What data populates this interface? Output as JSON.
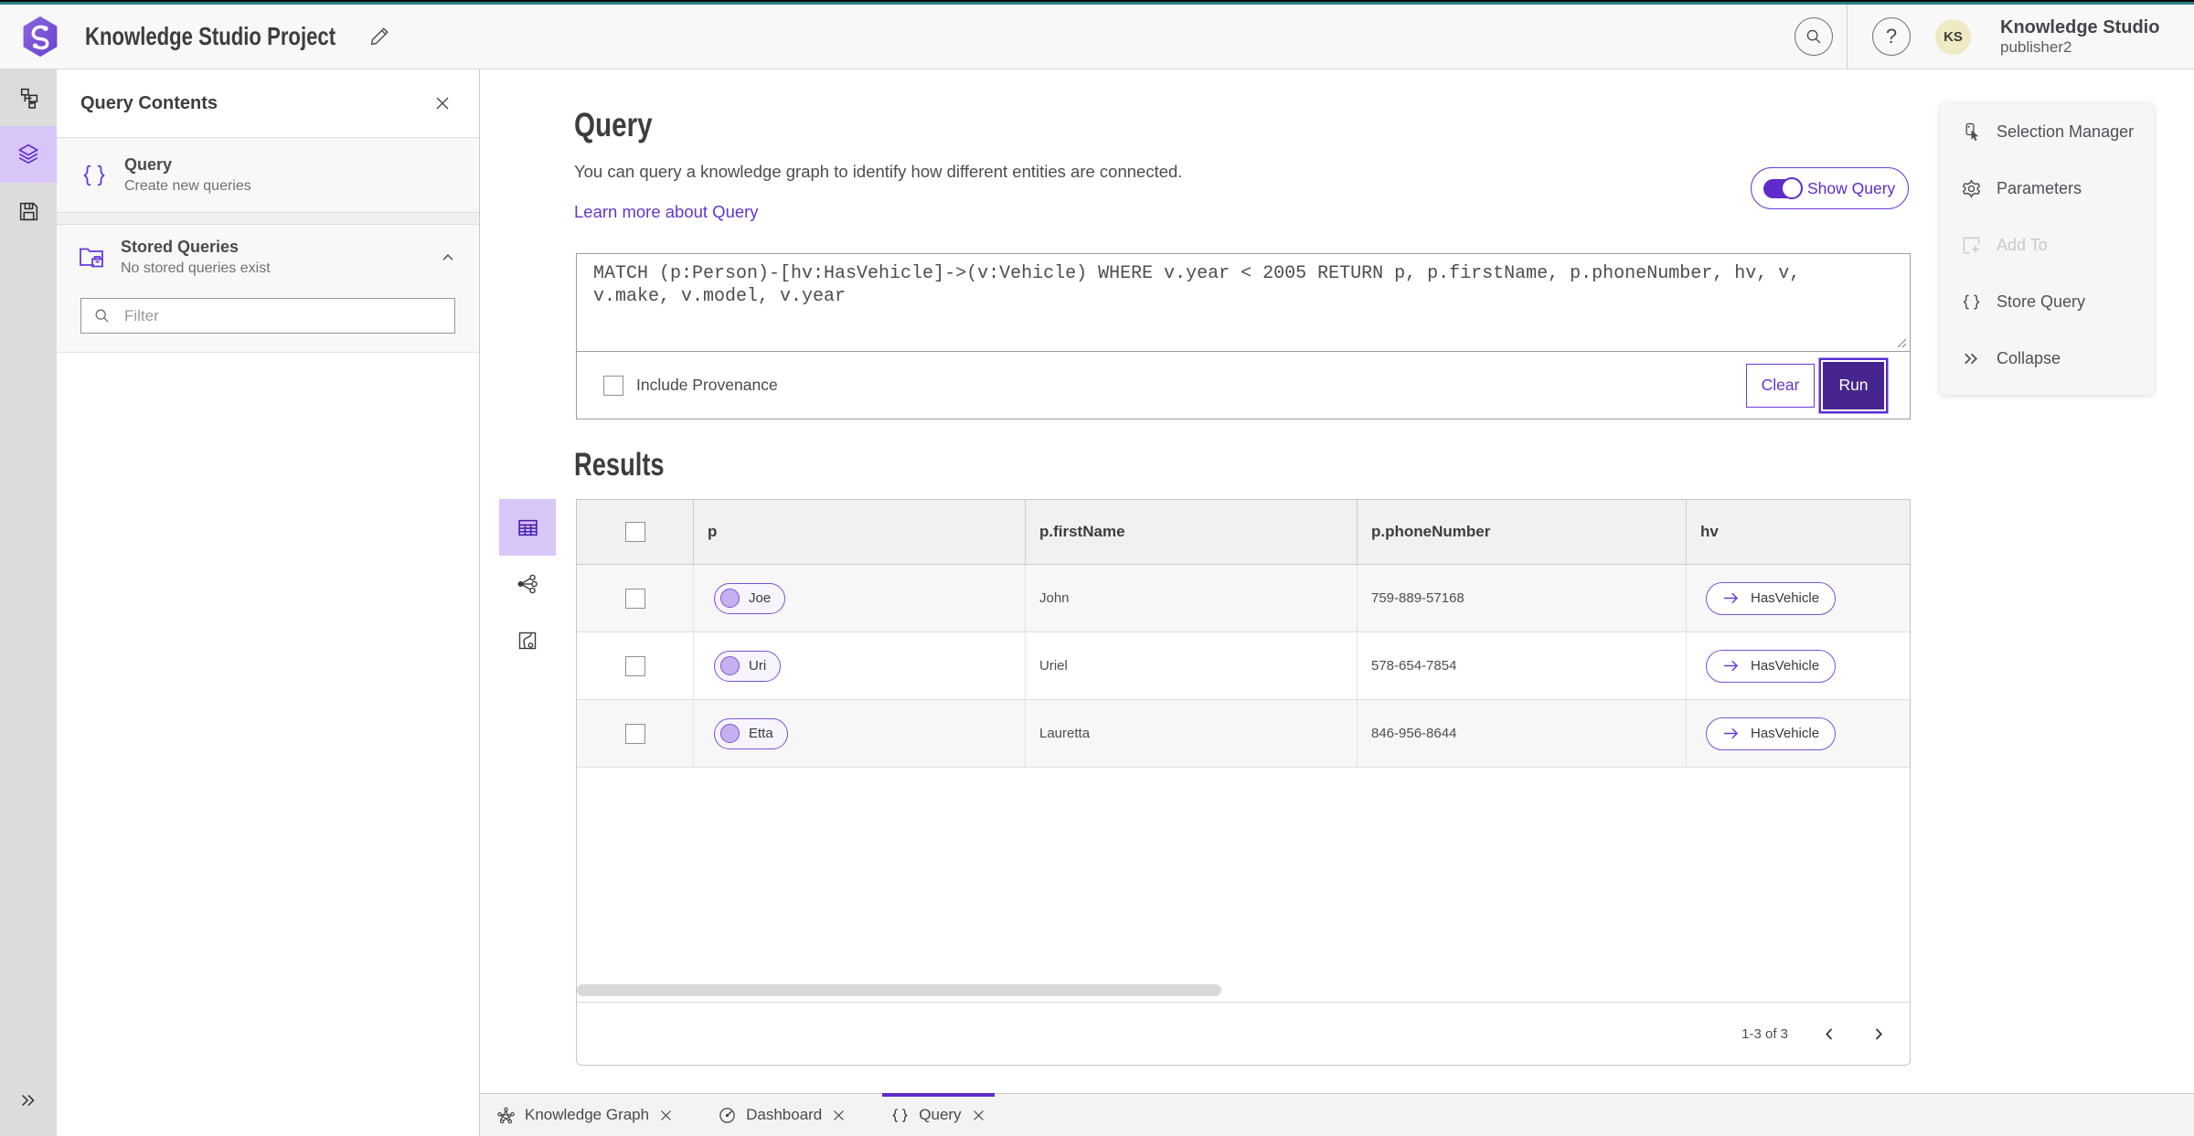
{
  "app": {
    "title": "Knowledge Studio Project",
    "user_name": "Knowledge Studio",
    "user_role": "publisher2",
    "avatar_initials": "KS"
  },
  "colors": {
    "brand_purple": "#5e2ccc",
    "selected_rail_bg": "#d9c6f9",
    "top_strip_teal": "#2e7e86",
    "run_button_fill": "#46268e",
    "avatar_bg": "#efeac3"
  },
  "icons": [
    "data-model-icon",
    "layers-icon",
    "save-icon",
    "expand-icon",
    "braces-icon",
    "stored-queries-folder-icon",
    "search-icon",
    "help-icon",
    "edit-pencil-icon",
    "close-icon",
    "chevron-up-icon",
    "table-view-icon",
    "graph-view-icon",
    "map-view-icon",
    "arrow-right-icon",
    "selection-manager-icon",
    "parameters-gear-icon",
    "add-to-icon",
    "store-query-icon",
    "collapse-icon",
    "knowledge-graph-icon",
    "dashboard-icon",
    "resize-grip-icon",
    "chevron-left-icon",
    "chevron-right-icon"
  ],
  "left_panel": {
    "title": "Query Contents",
    "query_item": {
      "title": "Query",
      "subtitle": "Create new queries"
    },
    "stored_item": {
      "title": "Stored Queries",
      "subtitle": "No stored queries exist"
    },
    "filter_placeholder": "Filter"
  },
  "query_section": {
    "title": "Query",
    "description": "You can query a knowledge graph to identify how different entities are connected.",
    "learn_more": "Learn more about Query",
    "show_query_label": "Show Query",
    "query_text": "MATCH (p:Person)-[hv:HasVehicle]->(v:Vehicle) WHERE v.year < 2005 RETURN p, p.firstName, p.phoneNumber, hv, v, v.make, v.model, v.year",
    "include_provenance_label": "Include Provenance",
    "clear_label": "Clear",
    "run_label": "Run"
  },
  "results": {
    "title": "Results",
    "columns": [
      "p",
      "p.firstName",
      "p.phoneNumber",
      "hv"
    ],
    "rows": [
      {
        "p": "Joe",
        "firstName": "John",
        "phoneNumber": "759-889-57168",
        "hv": "HasVehicle"
      },
      {
        "p": "Uri",
        "firstName": "Uriel",
        "phoneNumber": "578-654-7854",
        "hv": "HasVehicle"
      },
      {
        "p": "Etta",
        "firstName": "Lauretta",
        "phoneNumber": "846-956-8644",
        "hv": "HasVehicle"
      }
    ],
    "pagination": "1-3 of 3"
  },
  "side_menu": [
    {
      "label": "Selection Manager",
      "icon": "selection-manager-icon",
      "disabled": false
    },
    {
      "label": "Parameters",
      "icon": "parameters-gear-icon",
      "disabled": false
    },
    {
      "label": "Add To",
      "icon": "add-to-icon",
      "disabled": true
    },
    {
      "label": "Store Query",
      "icon": "store-query-icon",
      "disabled": false
    },
    {
      "label": "Collapse",
      "icon": "collapse-icon",
      "disabled": false
    }
  ],
  "bottom_tabs": [
    {
      "label": "Knowledge Graph",
      "icon": "knowledge-graph-icon",
      "active": false
    },
    {
      "label": "Dashboard",
      "icon": "dashboard-icon",
      "active": false
    },
    {
      "label": "Query",
      "icon": "braces-icon",
      "active": true
    }
  ]
}
